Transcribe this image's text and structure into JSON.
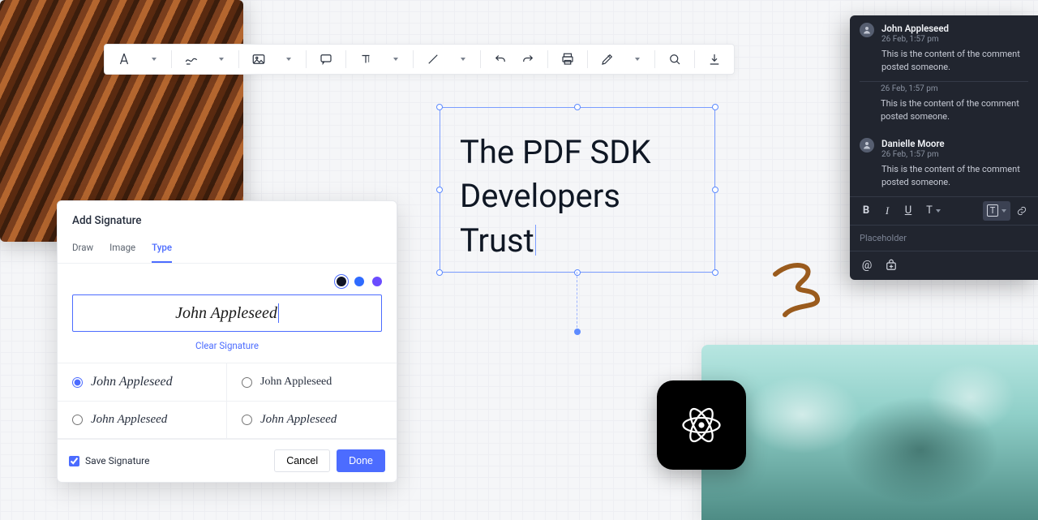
{
  "hero_text": "The PDF SDK Developers Trust",
  "toolbar": {
    "items": [
      "compass",
      "freehand",
      "image",
      "comment",
      "text",
      "line",
      "undo",
      "redo",
      "print",
      "edit",
      "search",
      "download"
    ]
  },
  "signature": {
    "title": "Add Signature",
    "tabs": {
      "draw": "Draw",
      "image": "Image",
      "type": "Type"
    },
    "active_tab": "type",
    "colors": [
      "#101424",
      "#2f6bff",
      "#6b4cff"
    ],
    "selected_color": 0,
    "typed_name": "John Appleseed",
    "clear_label": "Clear Signature",
    "options": [
      "John Appleseed",
      "John Appleseed",
      "John Appleseed",
      "John Appleseed"
    ],
    "selected_option": 0,
    "save_label": "Save Signature",
    "save_checked": true,
    "cancel_label": "Cancel",
    "done_label": "Done"
  },
  "comments": {
    "items": [
      {
        "name": "John Appleseed",
        "meta": "26 Feb, 1:57 pm",
        "text": "This is the content of the comment posted someone."
      },
      {
        "name": "",
        "meta": "26 Feb, 1:57 pm",
        "text": "This is the content of the comment posted someone."
      },
      {
        "name": "Danielle Moore",
        "meta": "26 Feb, 1:57 pm",
        "text": "This is the content of the comment posted someone."
      }
    ],
    "format_buttons": [
      "bold",
      "italic",
      "underline",
      "text-style",
      "text-highlight",
      "link"
    ],
    "placeholder": "Placeholder"
  }
}
